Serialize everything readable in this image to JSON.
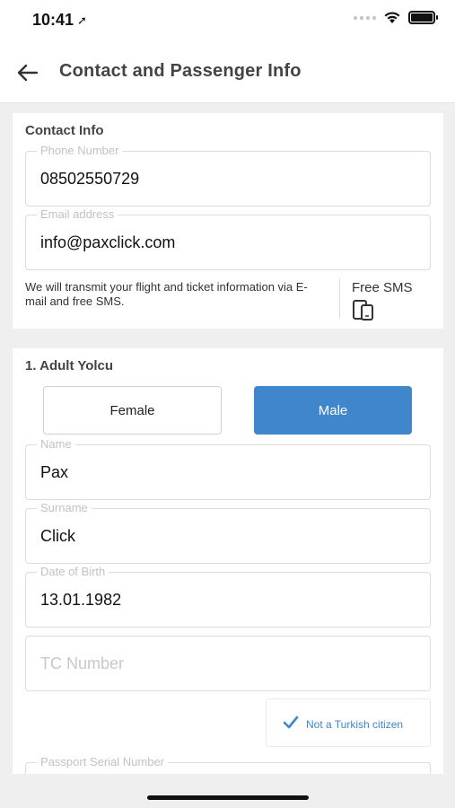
{
  "status_bar": {
    "time": "10:41"
  },
  "header": {
    "title": "Contact and Passenger Info"
  },
  "contact": {
    "title": "Contact Info",
    "phone_label": "Phone Number",
    "phone_value": "08502550729",
    "email_label": "Email address",
    "email_value": "info@paxclick.com",
    "sms_note": "We will transmit your flight and ticket information via E-mail and free SMS.",
    "free_sms_label": "Free SMS"
  },
  "passenger": {
    "title": "1. Adult Yolcu",
    "gender_female": "Female",
    "gender_male": "Male",
    "selected_gender": "Male",
    "name_label": "Name",
    "name_value": "Pax",
    "surname_label": "Surname",
    "surname_value": "Click",
    "dob_label": "Date of Birth",
    "dob_value": "13.01.1982",
    "tc_placeholder": "TC Number",
    "not_turkish_label": "Not a Turkish citizen",
    "passport_label": "Passport Serial Number"
  },
  "colors": {
    "accent": "#3f86cc",
    "background": "#efefef"
  }
}
